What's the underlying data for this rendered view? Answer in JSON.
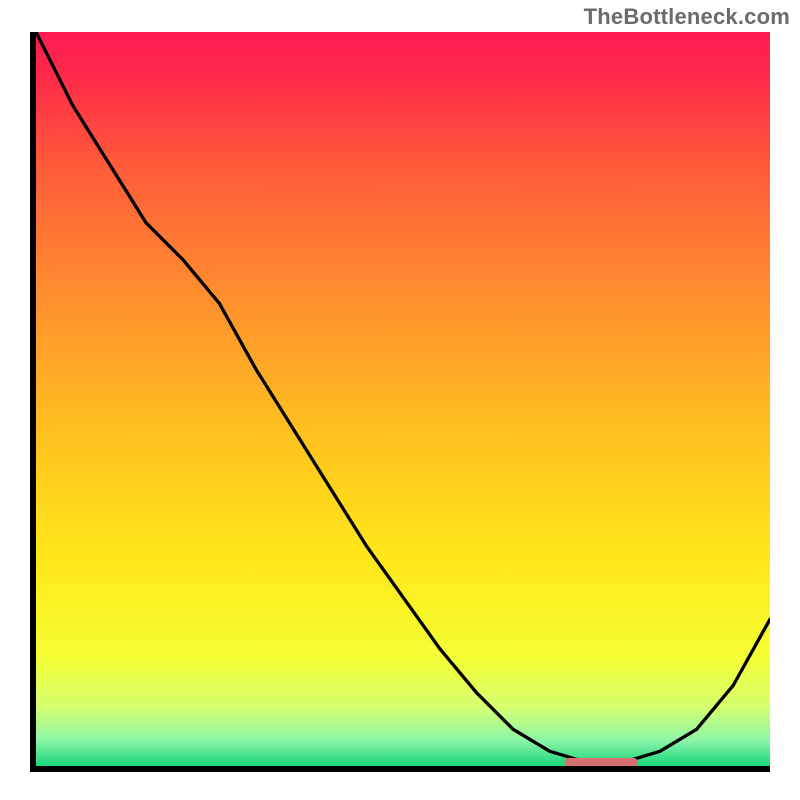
{
  "watermark": "TheBottleneck.com",
  "chart_data": {
    "type": "line",
    "x": [
      0.0,
      0.05,
      0.1,
      0.15,
      0.2,
      0.25,
      0.3,
      0.35,
      0.4,
      0.45,
      0.5,
      0.55,
      0.6,
      0.65,
      0.7,
      0.75,
      0.8,
      0.85,
      0.9,
      0.95,
      1.0
    ],
    "series": [
      {
        "name": "curve",
        "values": [
          1.0,
          0.9,
          0.82,
          0.74,
          0.69,
          0.63,
          0.54,
          0.46,
          0.38,
          0.3,
          0.23,
          0.16,
          0.1,
          0.05,
          0.02,
          0.005,
          0.005,
          0.02,
          0.05,
          0.11,
          0.2
        ]
      }
    ],
    "title": "",
    "xlabel": "",
    "ylabel": "",
    "xlim": [
      0,
      1
    ],
    "ylim": [
      0,
      1
    ],
    "sweet_spot": {
      "x_start": 0.72,
      "x_end": 0.82,
      "y": 0.005,
      "color": "#d86f6f"
    },
    "gradient_stops": [
      {
        "offset": 0.0,
        "color": "#ff1a52"
      },
      {
        "offset": 0.06,
        "color": "#ff2a4a"
      },
      {
        "offset": 0.18,
        "color": "#ff5a3a"
      },
      {
        "offset": 0.35,
        "color": "#ff8c2f"
      },
      {
        "offset": 0.55,
        "color": "#ffc21e"
      },
      {
        "offset": 0.72,
        "color": "#ffe81a"
      },
      {
        "offset": 0.85,
        "color": "#f5ff33"
      },
      {
        "offset": 0.92,
        "color": "#d4ff70"
      },
      {
        "offset": 0.965,
        "color": "#8cf5a8"
      },
      {
        "offset": 1.0,
        "color": "#19d67a"
      }
    ]
  }
}
